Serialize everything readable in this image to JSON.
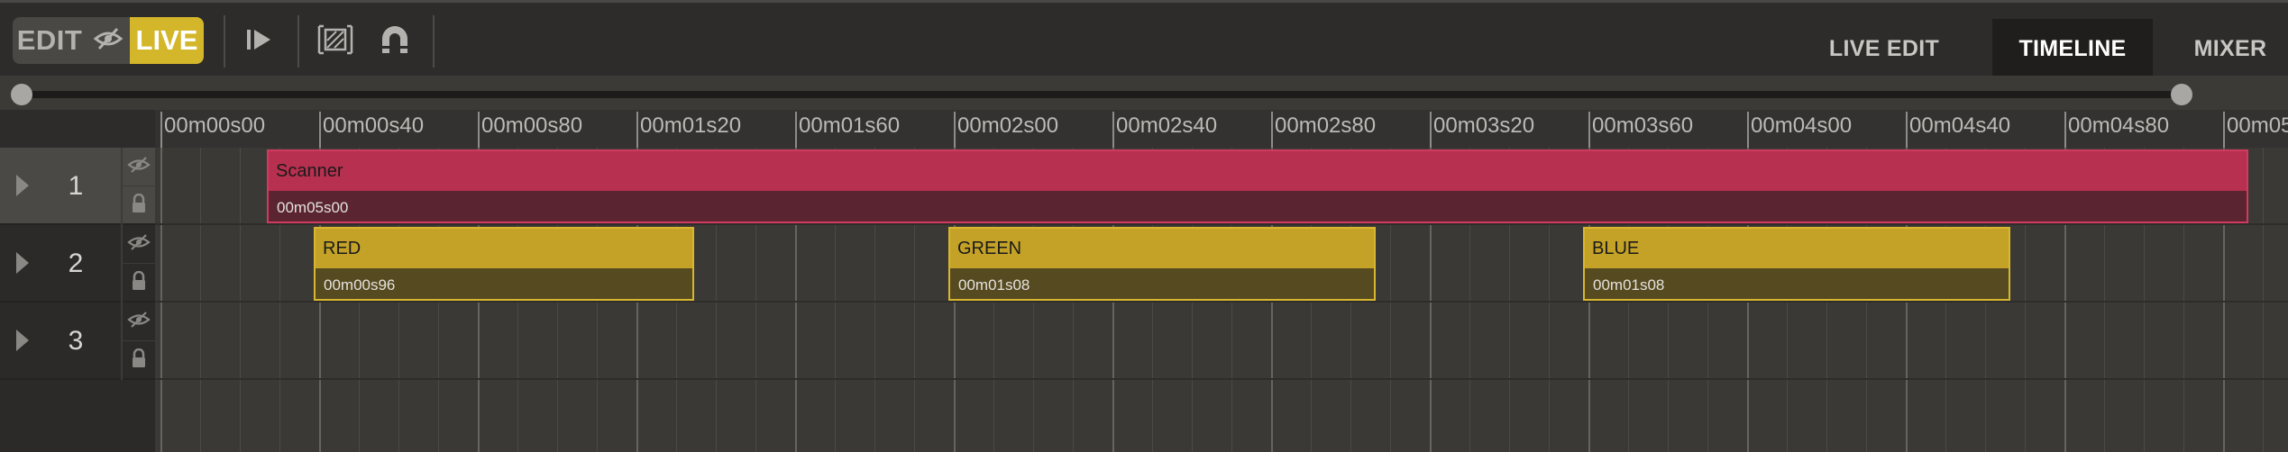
{
  "toolbar": {
    "edit_label": "EDIT",
    "live_label": "LIVE",
    "hide_icon": "eye-slash-icon",
    "play_icon": "play-from-start-icon",
    "select_icon": "selection-box-icon",
    "snap_icon": "magnet-icon",
    "accent_color": "#d4b62a"
  },
  "tabs": [
    {
      "label": "LIVE EDIT",
      "active": false
    },
    {
      "label": "TIMELINE",
      "active": true
    },
    {
      "label": "MIXER",
      "active": false
    }
  ],
  "ruler": {
    "labels": [
      "00m00s00",
      "00m00s40",
      "00m00s80",
      "00m01s20",
      "00m01s60",
      "00m02s00",
      "00m02s40",
      "00m02s80",
      "00m03s20",
      "00m03s60",
      "00m04s00",
      "00m04s40",
      "00m04s80",
      "00m05"
    ]
  },
  "tracks": [
    {
      "number": "1",
      "visibility_icon": "eye-slash-icon",
      "lock_icon": "lock-icon",
      "selected": true
    },
    {
      "number": "2",
      "visibility_icon": "eye-slash-icon",
      "lock_icon": "lock-icon",
      "selected": false
    },
    {
      "number": "3",
      "visibility_icon": "eye-slash-icon",
      "lock_icon": "lock-icon",
      "selected": false
    }
  ],
  "clips": [
    {
      "track": 1,
      "name": "Scanner",
      "duration": "00m05s00",
      "color": "#b83050",
      "dark_color": "#5a2530",
      "border": "#d03a60"
    },
    {
      "track": 2,
      "name": "RED",
      "duration": "00m00s96",
      "color": "#c4a228",
      "dark_color": "#564a20",
      "border": "#d8b630"
    },
    {
      "track": 2,
      "name": "GREEN",
      "duration": "00m01s08",
      "color": "#c4a228",
      "dark_color": "#564a20",
      "border": "#d8b630"
    },
    {
      "track": 2,
      "name": "BLUE",
      "duration": "00m01s08",
      "color": "#c4a228",
      "dark_color": "#564a20",
      "border": "#d8b630"
    }
  ]
}
